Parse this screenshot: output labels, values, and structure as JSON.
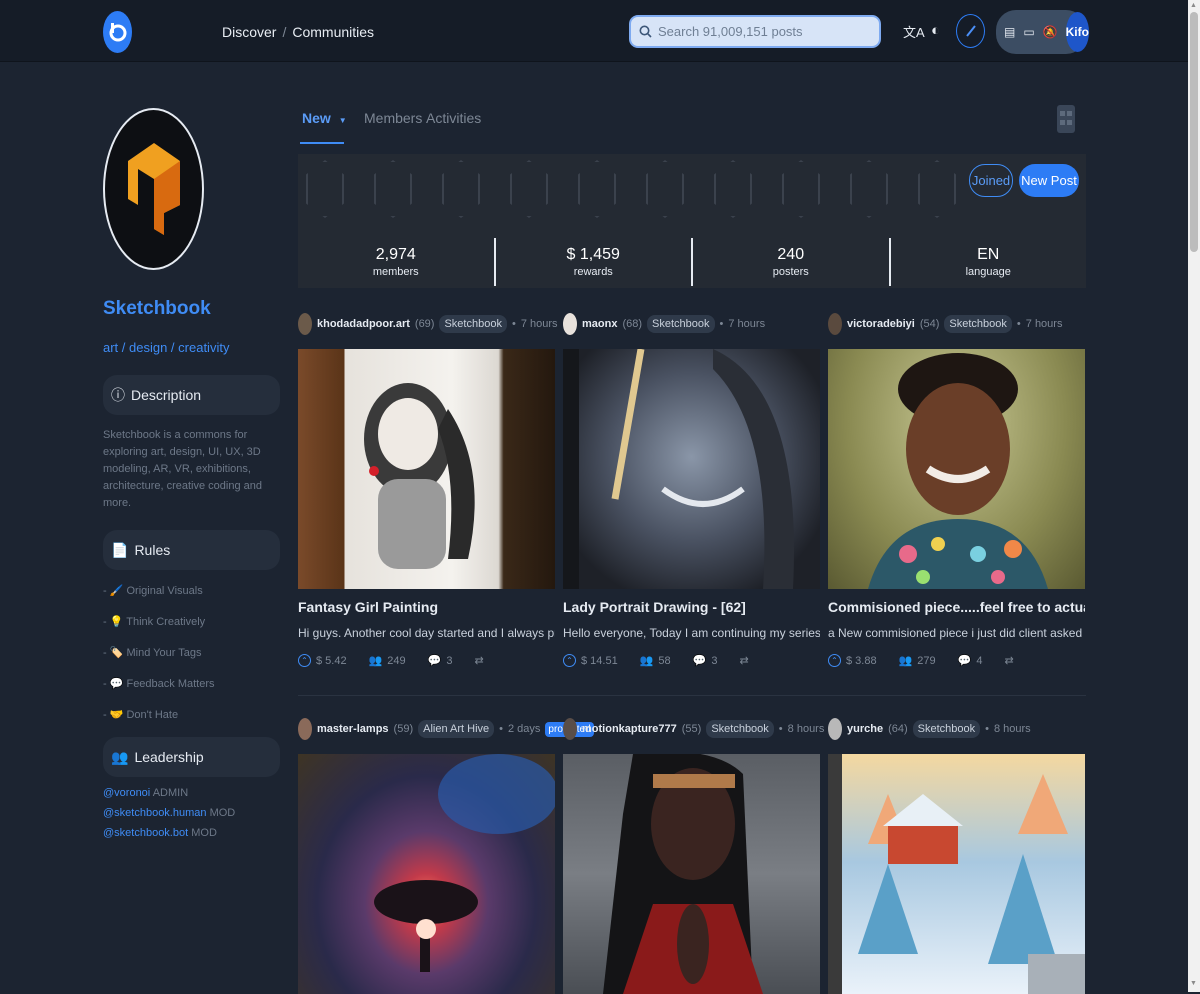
{
  "header": {
    "breadcrumb": [
      "Discover",
      "Communities"
    ],
    "search_placeholder": "Search 91,009,151 posts",
    "user_initials": "Kifo"
  },
  "community": {
    "name": "Sketchbook",
    "tags": "art / design / creativity",
    "description_label": "Description",
    "description": "Sketchbook is a commons for exploring art, design, UI, UX, 3D modeling, AR, VR, exhibitions, architecture, creative coding and more.",
    "rules_label": "Rules",
    "rules": [
      "- 🖌️ Original Visuals",
      "- 💡 Think Creatively",
      "- 🏷️ Mind Your Tags",
      "- 💬 Feedback Matters",
      "- 🤝 Don't Hate"
    ],
    "leadership_label": "Leadership",
    "leaders": [
      {
        "handle": "@voronoi",
        "role": "ADMIN"
      },
      {
        "handle": "@sketchbook.human",
        "role": "MOD"
      },
      {
        "handle": "@sketchbook.bot",
        "role": "MOD"
      }
    ]
  },
  "tabs": [
    {
      "label": "New",
      "active": true
    },
    {
      "label": "Members",
      "active": false
    },
    {
      "label": "Activities",
      "active": false
    }
  ],
  "banner": {
    "joined_label": "Joined",
    "new_post_label": "New Post",
    "stats": [
      {
        "value": "2,974",
        "label": "members"
      },
      {
        "value": "$ 1,459",
        "label": "rewards"
      },
      {
        "value": "240",
        "label": "posters"
      },
      {
        "value": "EN",
        "label": "language"
      }
    ]
  },
  "posts": [
    {
      "author": "khodadadpoor.art",
      "rep": "(69)",
      "community": "Sketchbook",
      "time": "7 hours",
      "title": "Fantasy Girl Painting",
      "body": "Hi guys. Another cool day started and I always prepared to share my art",
      "payout": "$ 5.42",
      "votes": "249",
      "comments": "3",
      "promoted": ""
    },
    {
      "author": "maonx",
      "rep": "(68)",
      "community": "Sketchbook",
      "time": "7 hours",
      "title": "Lady Portrait Drawing - [62]",
      "body": "Hello everyone, Today I am continuing my series of female portraits",
      "payout": "$ 14.51",
      "votes": "58",
      "comments": "3",
      "promoted": ""
    },
    {
      "author": "victoradebiyi",
      "rep": "(54)",
      "community": "Sketchbook",
      "time": "7 hours",
      "title": "Commisioned piece.....feel free to actually get one",
      "body": "a New commisioned piece i just did client asked me to draw",
      "payout": "$ 3.88",
      "votes": "279",
      "comments": "4",
      "promoted": ""
    },
    {
      "author": "master-lamps",
      "rep": "(59)",
      "community": "Alien Art Hive",
      "time": "2 days",
      "promoted": "promoted"
    },
    {
      "author": "motionkapture777",
      "rep": "(55)",
      "community": "Sketchbook",
      "time": "8 hours",
      "promoted": ""
    },
    {
      "author": "yurche",
      "rep": "(64)",
      "community": "Sketchbook",
      "time": "8 hours",
      "promoted": ""
    }
  ],
  "icons": {
    "logo": "ecency-logo-icon",
    "search": "search-icon",
    "translate": "translate-icon",
    "theme": "theme-toggle-icon",
    "pencil": "pencil-icon"
  }
}
